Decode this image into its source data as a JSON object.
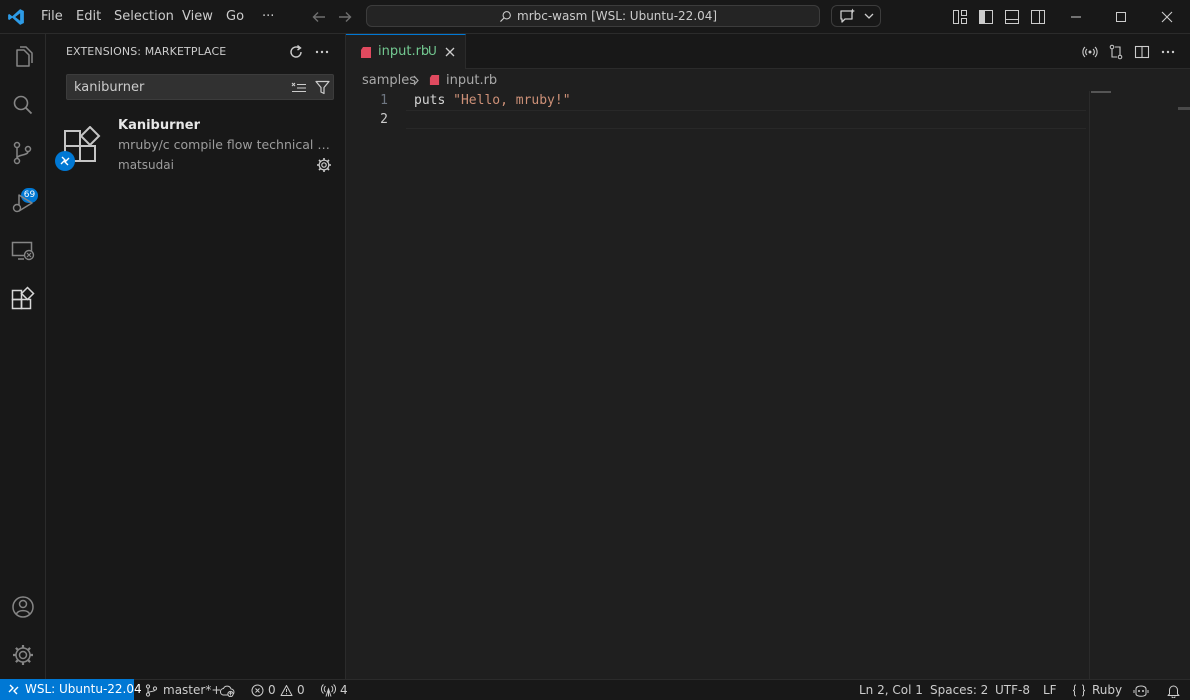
{
  "window": {
    "title": "mrbc-wasm [WSL: Ubuntu-22.04]",
    "menu": [
      "File",
      "Edit",
      "Selection",
      "View",
      "Go",
      "···"
    ]
  },
  "colors": {
    "accent": "#0078d4",
    "modified_git": "#73c991",
    "ruby_icon": "#e04a5f",
    "string": "#ce9178"
  },
  "activity_bar": {
    "icons": [
      "files-icon",
      "search-icon",
      "source-control-icon",
      "run-debug-icon",
      "remote-explorer-icon",
      "extensions-icon",
      "account-icon",
      "settings-gear-icon"
    ],
    "source_control_badge": "69"
  },
  "sidebar": {
    "title": "EXTENSIONS: MARKETPLACE",
    "search_value": "kaniburner",
    "extension": {
      "name": "Kaniburner",
      "description": "mruby/c compile flow technical verification.",
      "publisher": "matsudai"
    }
  },
  "editor": {
    "tab": {
      "label": "input.rb",
      "badge": "U"
    },
    "breadcrumb": [
      "samples",
      "input.rb"
    ],
    "lines": [
      {
        "number": "1",
        "keyword": "puts ",
        "string": "\"Hello, mruby!\""
      },
      {
        "number": "2",
        "keyword": "",
        "string": ""
      }
    ]
  },
  "statusbar": {
    "remote": "WSL: Ubuntu-22.04",
    "branch": "master*+",
    "errors": "0",
    "warnings": "0",
    "ports": "4",
    "position": "Ln 2, Col 1",
    "spaces": "Spaces: 2",
    "encoding": "UTF-8",
    "eol": "LF",
    "language": "Ruby"
  }
}
